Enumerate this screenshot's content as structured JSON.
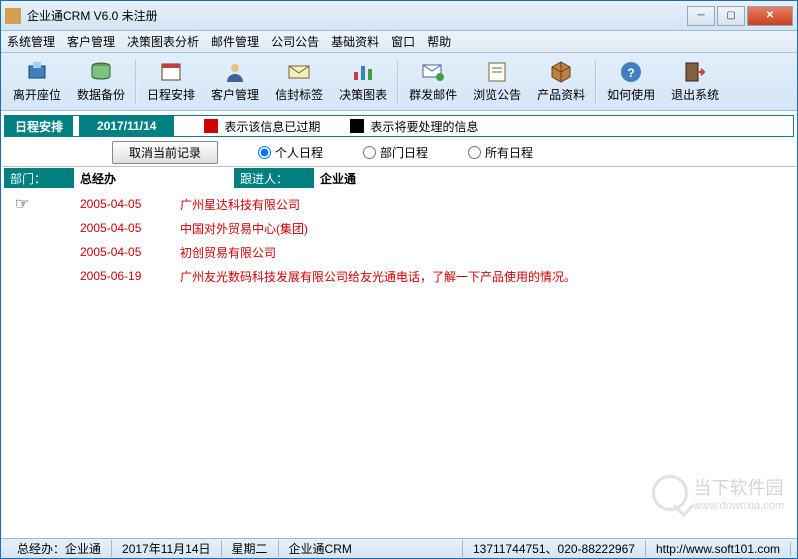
{
  "window": {
    "title": "企业通CRM V6.0    未注册"
  },
  "menu": [
    "系统管理",
    "客户管理",
    "决策图表分析",
    "邮件管理",
    "公司公告",
    "基础资料",
    "窗口",
    "帮助"
  ],
  "toolbar": [
    {
      "label": "离开座位",
      "icon": "seat"
    },
    {
      "label": "数据备份",
      "icon": "backup"
    },
    {
      "label": "日程安排",
      "icon": "calendar"
    },
    {
      "label": "客户管理",
      "icon": "customer"
    },
    {
      "label": "信封标签",
      "icon": "envelope"
    },
    {
      "label": "决策图表",
      "icon": "chart"
    },
    {
      "label": "群发邮件",
      "icon": "mail"
    },
    {
      "label": "浏览公告",
      "icon": "notice"
    },
    {
      "label": "产品资料",
      "icon": "product"
    },
    {
      "label": "如何使用",
      "icon": "help"
    },
    {
      "label": "退出系统",
      "icon": "exit"
    }
  ],
  "legend": {
    "title": "日程安排",
    "date": "2017/11/14",
    "expired": "表示该信息已过期",
    "pending": "表示将要处理的信息"
  },
  "filter": {
    "cancel_btn": "取消当前记录",
    "opts": [
      "个人日程",
      "部门日程",
      "所有日程"
    ],
    "selected": 0
  },
  "header": {
    "c1": "部门：",
    "c2": "总经办",
    "c3": "跟进人：",
    "c4": "企业通"
  },
  "rows": [
    {
      "date": "2005-04-05",
      "text": "广州星达科技有限公司",
      "ptr": true
    },
    {
      "date": "2005-04-05",
      "text": "中国对外贸易中心(集团)"
    },
    {
      "date": "2005-04-05",
      "text": "初创贸易有限公司"
    },
    {
      "date": "2005-06-19",
      "text": "广州友光数码科技发展有限公司给友光通电话，了解一下产品使用的情况。"
    }
  ],
  "statusbar": {
    "dept": "总经办：企业通",
    "date": "2017年11月14日",
    "weekday": "星期二",
    "app": "企业通CRM",
    "phone": "13711744751、020-88222967",
    "url": "http://www.soft101.com"
  },
  "watermark": {
    "text": "当下软件园",
    "url": "www.downxia.com"
  }
}
